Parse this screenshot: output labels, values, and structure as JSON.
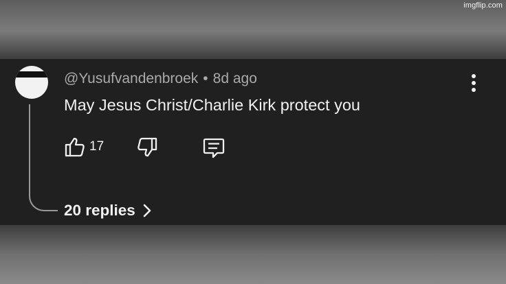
{
  "watermark": "imgflip.com",
  "comment": {
    "author": "@Yusufvandenbroek",
    "separator": "•",
    "time": "8d ago",
    "text": "May Jesus Christ/Charlie Kirk protect you",
    "like_count": "17",
    "replies_label": "20 replies"
  },
  "icons": {
    "like": "thumbs-up-icon",
    "dislike": "thumbs-down-icon",
    "reply": "comment-icon",
    "more": "vertical-dots-icon",
    "replies": "chevron-right-icon"
  },
  "colors": {
    "card_background": "#202020",
    "text_primary": "#f1f1f1",
    "text_secondary": "#aaaaaa",
    "thread_line": "#9a9a9a"
  }
}
